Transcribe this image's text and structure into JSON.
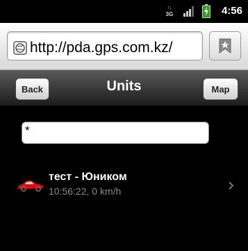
{
  "status_bar": {
    "network": "3G",
    "time": "4:56"
  },
  "browser": {
    "url": "http://pda.gps.com.kz/"
  },
  "header": {
    "back_label": "Back",
    "title": "Units",
    "map_label": "Map"
  },
  "search": {
    "value": "*"
  },
  "units": [
    {
      "name": "тест - Юником",
      "info": "10:56:22, 0 km/h"
    }
  ],
  "colors": {
    "header_bg": "#3a3a3a",
    "body_bg": "#000000",
    "car_icon": "#cc1111",
    "secondary_text": "#8a8a8a"
  }
}
